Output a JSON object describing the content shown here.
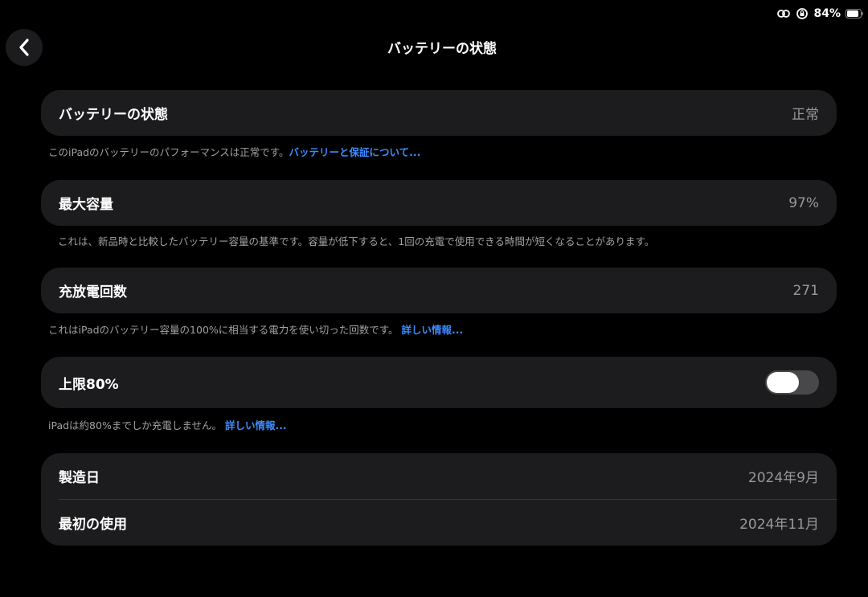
{
  "status_bar": {
    "battery_percent": "84%"
  },
  "header": {
    "title": "バッテリーの状態"
  },
  "battery_health": {
    "label": "バッテリーの状態",
    "value": "正常",
    "footnote": "このiPadのバッテリーのパフォーマンスは正常です。",
    "link": "バッテリーと保証について..."
  },
  "max_capacity": {
    "label": "最大容量",
    "value": "97%",
    "footnote": "これは、新品時と比較したバッテリー容量の基準です。容量が低下すると、1回の充電で使用できる時間が短くなることがあります。"
  },
  "cycle_count": {
    "label": "充放電回数",
    "value": "271",
    "footnote": "これはiPadのバッテリー容量の100%に相当する電力を使い切った回数です。",
    "link": "詳しい情報..."
  },
  "limit": {
    "label": "上限80%",
    "footnote": "iPadは約80%までしか充電しません。",
    "link": "詳しい情報..."
  },
  "dates": {
    "manufacture_label": "製造日",
    "manufacture_value": "2024年9月",
    "first_use_label": "最初の使用",
    "first_use_value": "2024年11月"
  },
  "colors": {
    "background": "#000000",
    "card": "#1c1c1e",
    "link": "#3b8cff",
    "secondary_text": "#98989f"
  }
}
